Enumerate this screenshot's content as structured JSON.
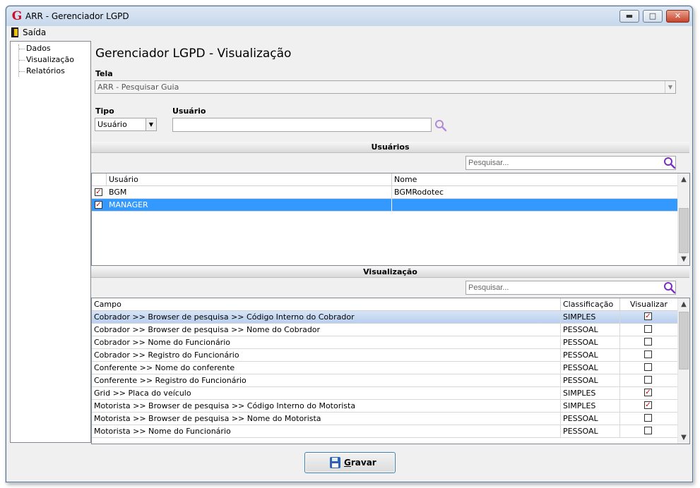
{
  "window": {
    "title": "ARR - Gerenciador LGPD",
    "app_icon_letter": "G"
  },
  "menu": {
    "exit_label": "Saída"
  },
  "nav": {
    "items": [
      "Dados",
      "Visualização",
      "Relatórios"
    ]
  },
  "page": {
    "title": "Gerenciador LGPD - Visualização",
    "tela_label": "Tela",
    "tela_value": "ARR - Pesquisar Guia",
    "tipo_label": "Tipo",
    "tipo_value": "Usuário",
    "usuario_label": "Usuário",
    "usuario_value": ""
  },
  "users_section": {
    "title": "Usuários",
    "search_placeholder": "Pesquisar...",
    "columns": [
      "Usuário",
      "Nome"
    ],
    "rows": [
      {
        "checked": true,
        "usuario": "BGM",
        "nome": "BGMRodotec",
        "selected": false
      },
      {
        "checked": true,
        "usuario": "MANAGER",
        "nome": "",
        "selected": true
      }
    ]
  },
  "view_section": {
    "title": "Visualização",
    "search_placeholder": "Pesquisar...",
    "columns": [
      "Campo",
      "Classificação",
      "Visualizar"
    ],
    "rows": [
      {
        "campo": "Cobrador >> Browser de pesquisa >> Código Interno do Cobrador",
        "classificacao": "SIMPLES",
        "visualizar": true,
        "selected": true
      },
      {
        "campo": "Cobrador >> Browser de pesquisa >> Nome do Cobrador",
        "classificacao": "PESSOAL",
        "visualizar": false,
        "selected": false
      },
      {
        "campo": "Cobrador >> Nome do Funcionário",
        "classificacao": "PESSOAL",
        "visualizar": false,
        "selected": false
      },
      {
        "campo": "Cobrador >> Registro do Funcionário",
        "classificacao": "PESSOAL",
        "visualizar": false,
        "selected": false
      },
      {
        "campo": "Conferente >> Nome do conferente",
        "classificacao": "PESSOAL",
        "visualizar": false,
        "selected": false
      },
      {
        "campo": "Conferente >> Registro do Funcionário",
        "classificacao": "PESSOAL",
        "visualizar": false,
        "selected": false
      },
      {
        "campo": "Grid >> Placa do veículo",
        "classificacao": "SIMPLES",
        "visualizar": true,
        "selected": false
      },
      {
        "campo": "Motorista >> Browser de pesquisa >> Código Interno do Motorista",
        "classificacao": "SIMPLES",
        "visualizar": true,
        "selected": false
      },
      {
        "campo": "Motorista >> Browser de pesquisa >> Nome do Motorista",
        "classificacao": "PESSOAL",
        "visualizar": false,
        "selected": false
      },
      {
        "campo": "Motorista >> Nome do Funcionário",
        "classificacao": "PESSOAL",
        "visualizar": false,
        "selected": false
      }
    ]
  },
  "footer": {
    "save_label": "Gravar",
    "save_accesskey": "G"
  },
  "colors": {
    "selection_blue": "#3399ff",
    "check_red": "#d00000",
    "search_icon": "#7b2fbe"
  }
}
